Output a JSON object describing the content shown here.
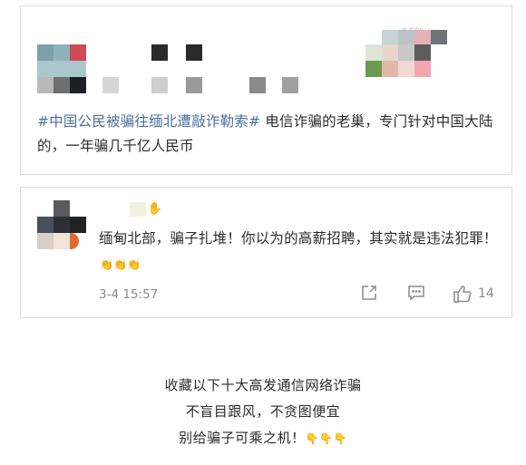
{
  "post": {
    "hashtag": "#中国公民被骗往缅北遭敲诈勒索#",
    "body": " 电信诈骗的老巢，专门针对中国大陆的，一年骗几千亿人民币",
    "avatar_icon": "mosaic-avatar-icon",
    "watermark_icon": "weibo-watermark-icon"
  },
  "comment": {
    "text": "缅甸北部，骗子扎堆！你以为的高薪招聘，其实就是违法犯罪！",
    "emojis": "👏👏👏",
    "timestamp": "3-4 15:57",
    "like_count": "14",
    "avatar_icon": "mosaic-avatar-icon",
    "badge_icon": "hand-badge-icon",
    "share_icon": "share-icon",
    "reply_icon": "comment-icon",
    "like_icon": "thumbs-up-icon"
  },
  "footer": {
    "line1": "收藏以下十大高发通信网络诈骗",
    "line2": "不盲目跟风，不贪图便宜",
    "line3": "别给骗子可乘之机！",
    "line3_emojis": "👇👇👇"
  },
  "colors": {
    "hashtag": "#4a6f9e",
    "text": "#2b2b2b",
    "meta": "#8a8a8a",
    "border": "#dcdcdc"
  }
}
